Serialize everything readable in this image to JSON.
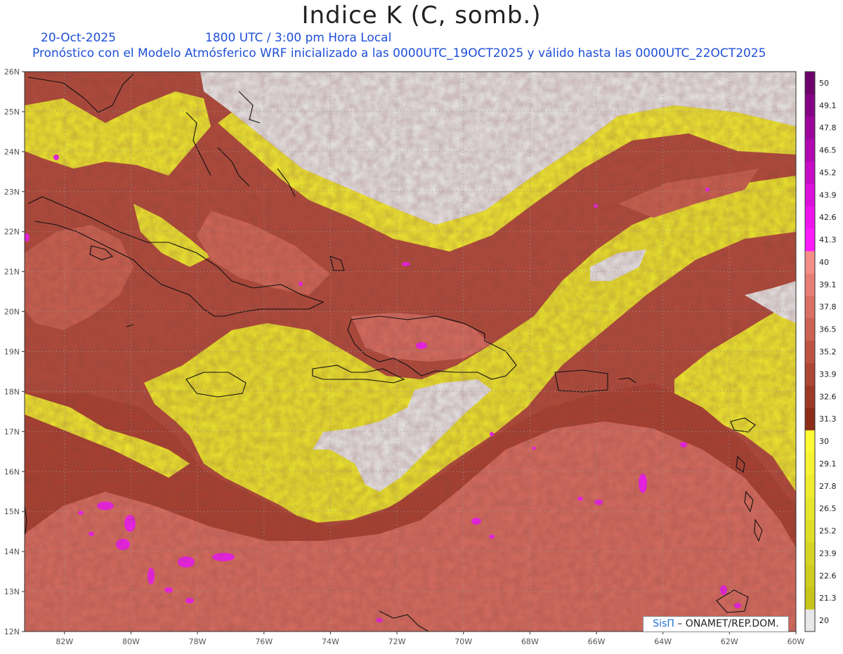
{
  "header": {
    "title": "Indice K (C, somb.)",
    "date": "20-Oct-2025",
    "time": "1800 UTC / 3:00 pm Hora Local",
    "description": "Pronóstico con el Modelo Atmósferico WRF inicializado a las 0000UTC_19OCT2025 y válido hasta las  0000UTC_22OCT2025"
  },
  "map": {
    "lat_labels": [
      "26N",
      "25N",
      "24N",
      "23N",
      "22N",
      "21N",
      "20N",
      "19N",
      "18N",
      "17N",
      "16N",
      "15N",
      "14N",
      "13N",
      "12N"
    ],
    "lon_labels": [
      "82W",
      "80W",
      "78W",
      "76W",
      "74W",
      "72W",
      "70W",
      "68W",
      "66W",
      "64W",
      "62W",
      "60W"
    ],
    "lat_range": [
      12,
      26
    ],
    "lon_range": [
      -83.2,
      -60
    ],
    "gridlines": "dotted",
    "background_color": "#e8e8e8"
  },
  "colorbar": {
    "levels": [
      {
        "label": "20",
        "color": "#e8e8e8"
      },
      {
        "label": "21.3",
        "color": "#c7c41a"
      },
      {
        "label": "22.6",
        "color": "#cfcc1f"
      },
      {
        "label": "23.9",
        "color": "#d7d524"
      },
      {
        "label": "25.2",
        "color": "#dfdd28"
      },
      {
        "label": "26.5",
        "color": "#e7e52c"
      },
      {
        "label": "27.8",
        "color": "#efec2f"
      },
      {
        "label": "29.1",
        "color": "#f6f332"
      },
      {
        "label": "30",
        "color": "#fdfb35"
      },
      {
        "label": "31.3",
        "color": "#8c2e1a"
      },
      {
        "label": "32.6",
        "color": "#9d3a27"
      },
      {
        "label": "33.9",
        "color": "#ad4634"
      },
      {
        "label": "35.2",
        "color": "#bd5443"
      },
      {
        "label": "36.5",
        "color": "#cc6253"
      },
      {
        "label": "37.8",
        "color": "#da7064"
      },
      {
        "label": "39.1",
        "color": "#e87f76"
      },
      {
        "label": "40",
        "color": "#f58e88"
      },
      {
        "label": "41.3",
        "color": "#ff1aff"
      },
      {
        "label": "42.6",
        "color": "#ee14ee"
      },
      {
        "label": "43.9",
        "color": "#db10db"
      },
      {
        "label": "45.2",
        "color": "#c70cc7"
      },
      {
        "label": "46.5",
        "color": "#b208b2"
      },
      {
        "label": "47.8",
        "color": "#9c069c"
      },
      {
        "label": "49.1",
        "color": "#850485"
      },
      {
        "label": "50",
        "color": "#6d026d"
      }
    ]
  },
  "credit": {
    "brand": "SisΠ",
    "text": " – ONAMET/REP.DOM."
  }
}
